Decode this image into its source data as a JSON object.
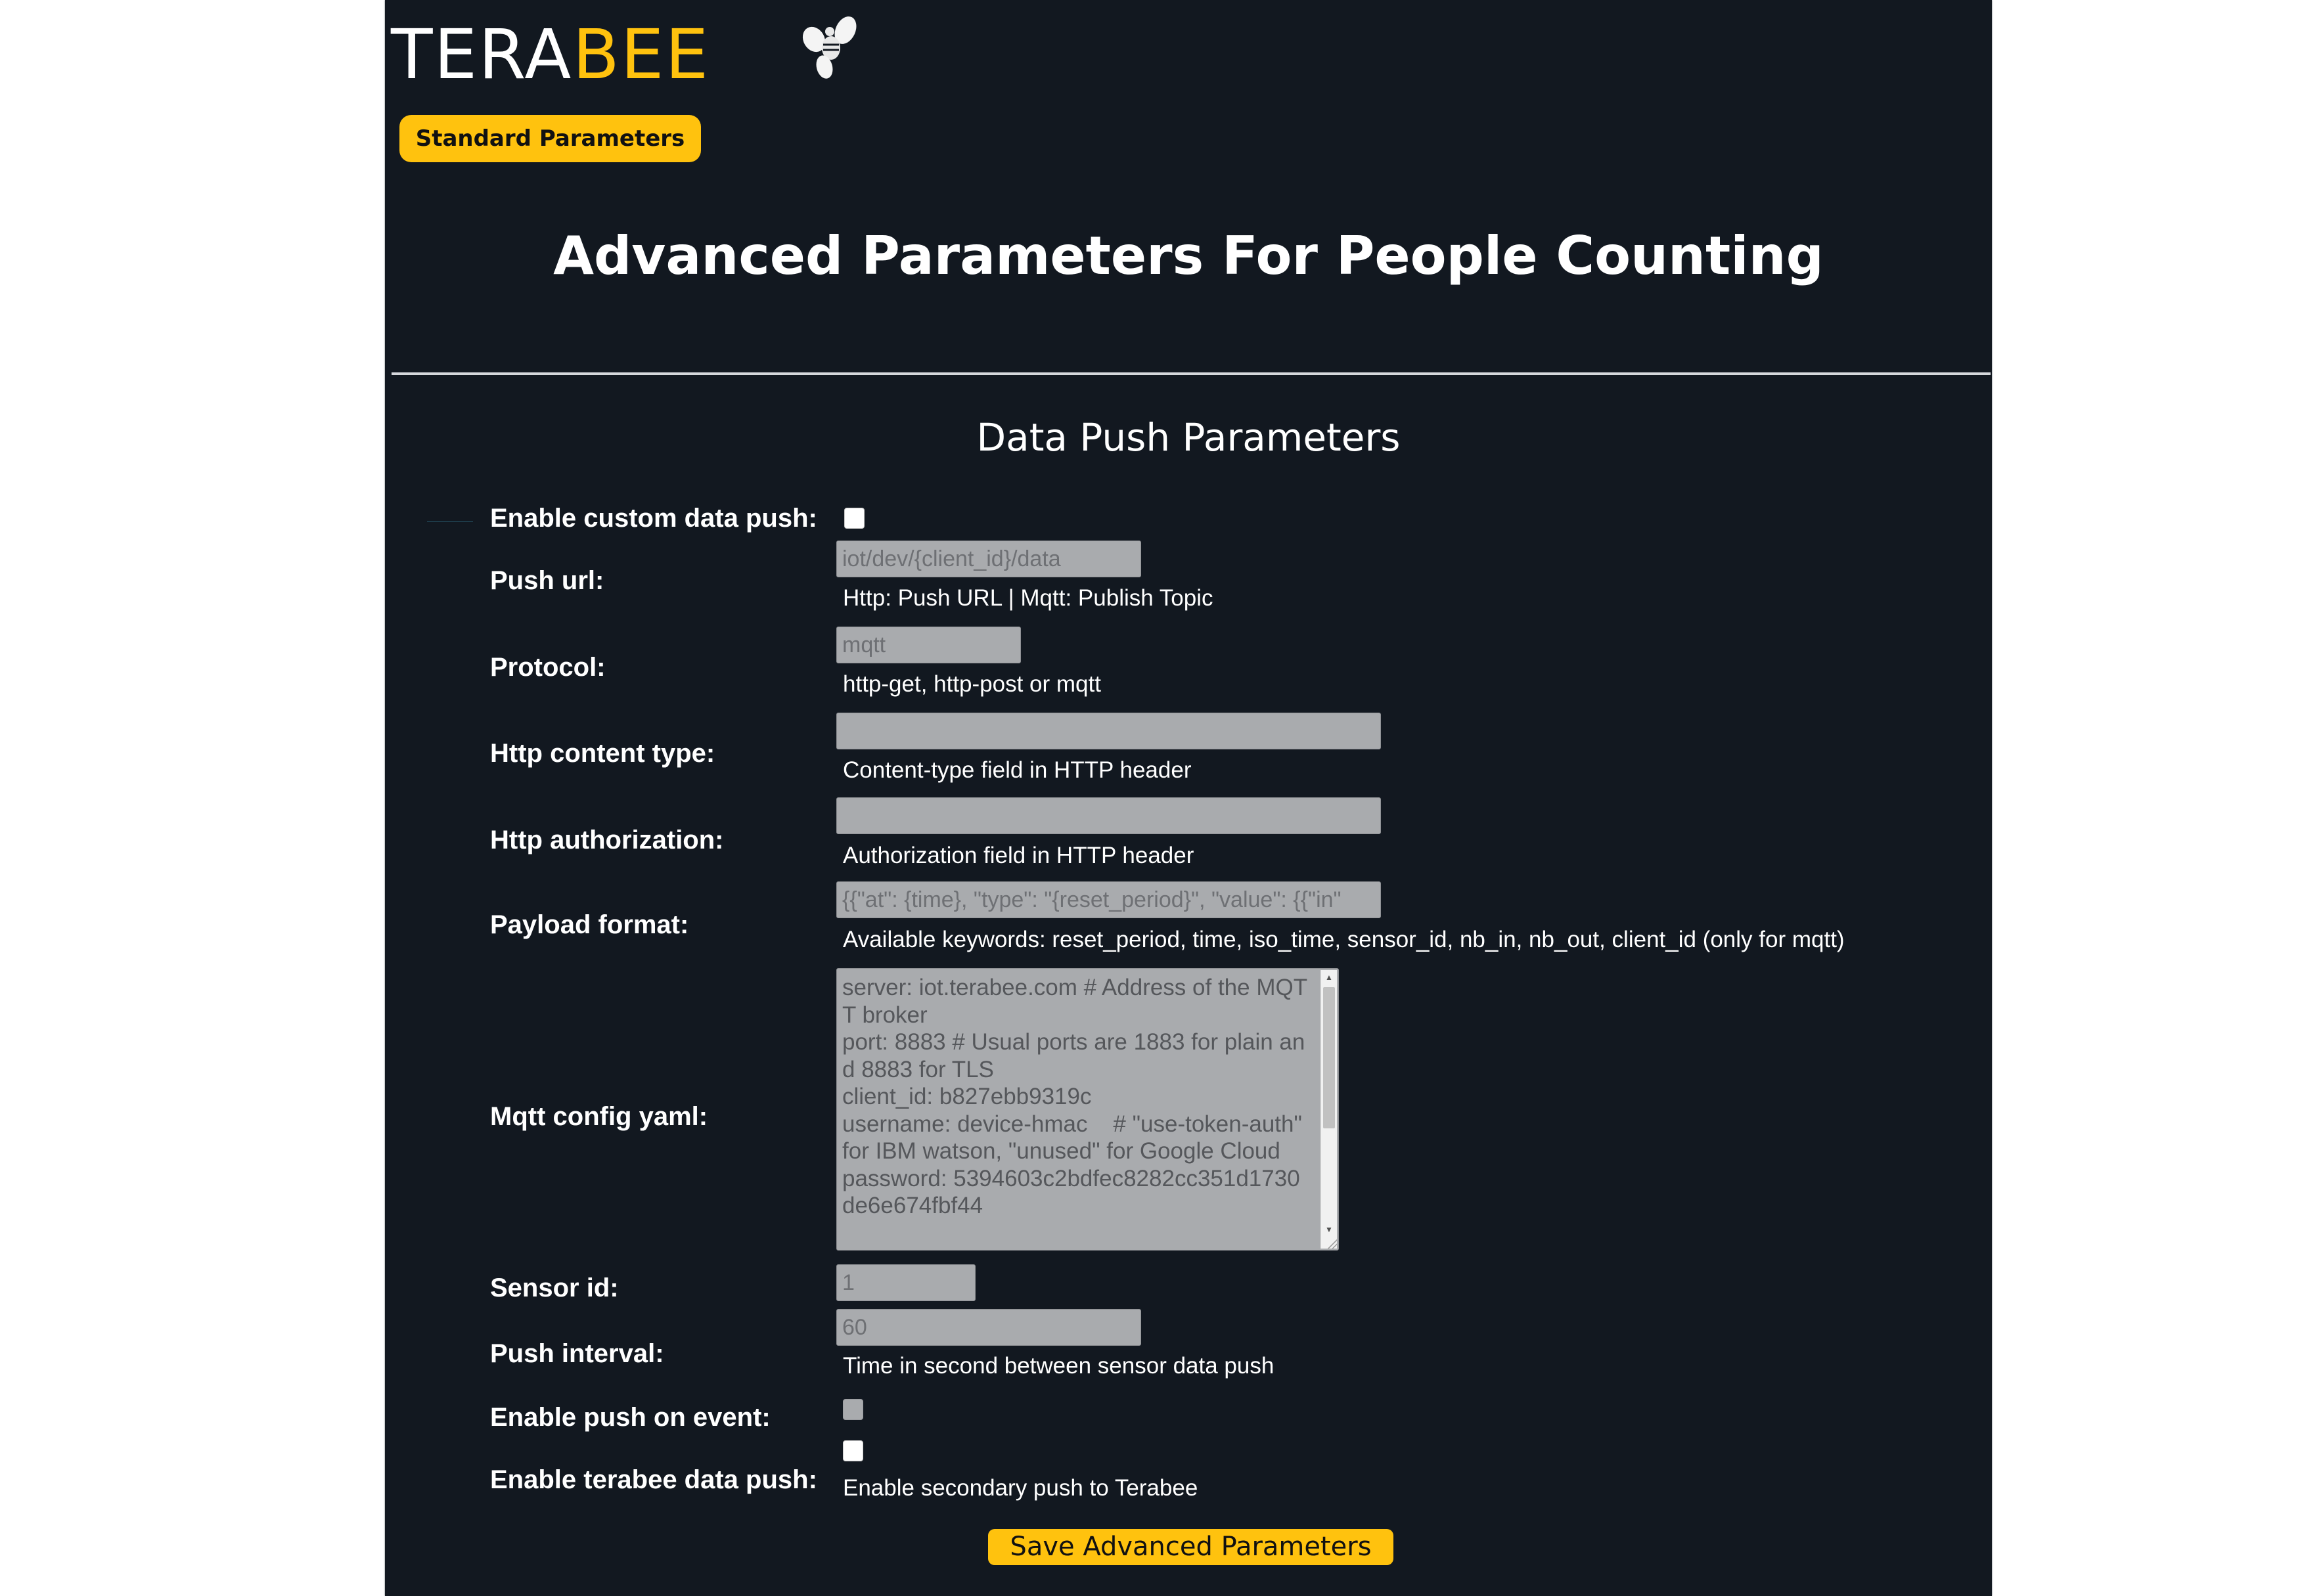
{
  "brand": {
    "logo_part1": "TERA",
    "logo_part2": "BEE",
    "primary_color": "#FFC20E",
    "background_color": "#121820"
  },
  "nav": {
    "standard_parameters_label": "Standard Parameters"
  },
  "page": {
    "title": "Advanced Parameters For People Counting",
    "section_title": "Data Push Parameters"
  },
  "form": {
    "enable_custom_data_push": {
      "label": "Enable custom data push:",
      "checked": false
    },
    "push_url": {
      "label": "Push url:",
      "placeholder": "iot/dev/{client_id}/data",
      "value": "",
      "help": "Http: Push URL | Mqtt: Publish Topic"
    },
    "protocol": {
      "label": "Protocol:",
      "placeholder": "mqtt",
      "value": "",
      "help": "http-get, http-post or mqtt"
    },
    "http_content_type": {
      "label": "Http content type:",
      "value": "",
      "help": "Content-type field in HTTP header"
    },
    "http_authorization": {
      "label": "Http authorization:",
      "value": "",
      "help": "Authorization field in HTTP header"
    },
    "payload_format": {
      "label": "Payload format:",
      "placeholder": "{{\"at\": {time}, \"type\": \"{reset_period}\", \"value\": {{\"in\"",
      "value": "",
      "help": "Available keywords: reset_period, time, iso_time, sensor_id, nb_in, nb_out, client_id (only for mqtt)"
    },
    "mqtt_config_yaml": {
      "label": "Mqtt config yaml:",
      "value": "server: iot.terabee.com # Address of the MQTT broker\nport: 8883 # Usual ports are 1883 for plain and 8883 for TLS\nclient_id: b827ebb9319c\nusername: device-hmac    # \"use-token-auth\" for IBM watson, \"unused\" for Google Cloud\npassword: 5394603c2bdfec8282cc351d1730de6e674fbf44",
      "scroll_fraction_visible": 0.52
    },
    "sensor_id": {
      "label": "Sensor id:",
      "placeholder": "1",
      "value": ""
    },
    "push_interval": {
      "label": "Push interval:",
      "placeholder": "60",
      "value": "",
      "help": "Time in second between sensor data push"
    },
    "enable_push_on_event": {
      "label": "Enable push on event:",
      "checked": false,
      "disabled": true
    },
    "enable_terabee_data_push": {
      "label": "Enable terabee data push:",
      "checked": false,
      "help": "Enable secondary push to Terabee"
    }
  },
  "actions": {
    "save_label": "Save Advanced Parameters"
  }
}
